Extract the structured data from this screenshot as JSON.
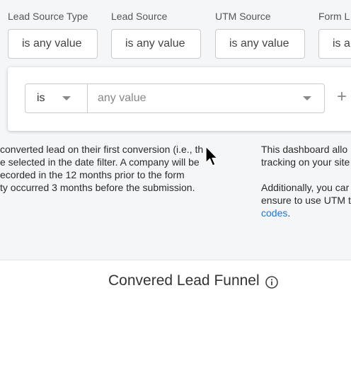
{
  "filters": [
    {
      "label": "Lead Source Type",
      "value": "is any value"
    },
    {
      "label": "Lead Source",
      "value": "is any value"
    },
    {
      "label": "UTM Source",
      "value": "is any value"
    },
    {
      "label": "Form L",
      "value": "is a"
    }
  ],
  "popover": {
    "operator": "is",
    "value_placeholder": "any value",
    "add_icon": "plus-icon"
  },
  "description_left": [
    "converted lead on their first conversion (i.e., th",
    "e selected in the date filter. A company will be",
    "ecorded in the 12 months prior to the form",
    "ty occurred 3 months before the submission."
  ],
  "description_right": {
    "para1": [
      "This dashboard allo",
      "tracking on your site"
    ],
    "para2": [
      "Additionally, you car",
      "ensure to use UTM t"
    ],
    "link_text": "codes",
    "link_suffix": "."
  },
  "chart": {
    "title": "Convered Lead Funnel",
    "icon": "info-icon"
  },
  "colors": {
    "link": "#1a73e8",
    "background": "#f5f6f8"
  }
}
